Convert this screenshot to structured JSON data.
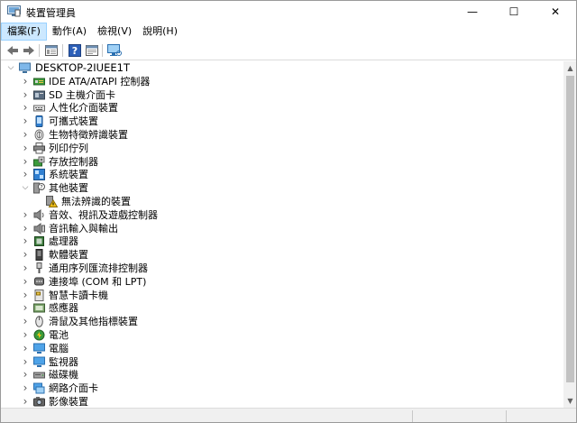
{
  "window": {
    "title": "裝置管理員",
    "minimize_glyph": "—",
    "maximize_glyph": "☐",
    "close_glyph": "✕"
  },
  "menu": [
    {
      "label": "檔案(F)",
      "active": true
    },
    {
      "label": "動作(A)",
      "active": false
    },
    {
      "label": "檢視(V)",
      "active": false
    },
    {
      "label": "說明(H)",
      "active": false
    }
  ],
  "toolbar": {
    "buttons": [
      "back-icon",
      "forward-icon",
      "properties-icon",
      "help-icon",
      "view-icon",
      "monitor-scan-icon"
    ]
  },
  "tree": {
    "root": {
      "label": "DESKTOP-2IUEE1T",
      "expanded": true
    },
    "items": [
      {
        "label": "IDE ATA/ATAPI 控制器",
        "icon": "ide-controller-icon",
        "expanded": false
      },
      {
        "label": "SD 主機介面卡",
        "icon": "sd-host-icon",
        "expanded": false
      },
      {
        "label": "人性化介面裝置",
        "icon": "hid-icon",
        "expanded": false
      },
      {
        "label": "可攜式裝置",
        "icon": "portable-device-icon",
        "expanded": false
      },
      {
        "label": "生物特徵辨識裝置",
        "icon": "biometric-icon",
        "expanded": false
      },
      {
        "label": "列印佇列",
        "icon": "printer-icon",
        "expanded": false
      },
      {
        "label": "存放控制器",
        "icon": "storage-controller-icon",
        "expanded": false
      },
      {
        "label": "系統裝置",
        "icon": "system-device-icon",
        "expanded": false
      },
      {
        "label": "其他裝置",
        "icon": "other-device-icon",
        "expanded": true,
        "children": [
          {
            "label": "無法辨識的裝置",
            "icon": "unknown-device-warning-icon"
          }
        ]
      },
      {
        "label": "音效、視訊及遊戲控制器",
        "icon": "sound-icon",
        "expanded": false
      },
      {
        "label": "音訊輸入與輸出",
        "icon": "audio-io-icon",
        "expanded": false
      },
      {
        "label": "處理器",
        "icon": "processor-icon",
        "expanded": false
      },
      {
        "label": "軟體裝置",
        "icon": "software-device-icon",
        "expanded": false
      },
      {
        "label": "通用序列匯流排控制器",
        "icon": "usb-icon",
        "expanded": false
      },
      {
        "label": "連接埠 (COM 和 LPT)",
        "icon": "port-icon",
        "expanded": false
      },
      {
        "label": "智慧卡讀卡機",
        "icon": "smartcard-icon",
        "expanded": false
      },
      {
        "label": "感應器",
        "icon": "sensor-icon",
        "expanded": false
      },
      {
        "label": "滑鼠及其他指標裝置",
        "icon": "mouse-icon",
        "expanded": false
      },
      {
        "label": "電池",
        "icon": "battery-icon",
        "expanded": false
      },
      {
        "label": "電腦",
        "icon": "computer-icon",
        "expanded": false
      },
      {
        "label": "監視器",
        "icon": "monitor-icon",
        "expanded": false
      },
      {
        "label": "磁碟機",
        "icon": "disk-drive-icon",
        "expanded": false
      },
      {
        "label": "網路介面卡",
        "icon": "network-adapter-icon",
        "expanded": false
      },
      {
        "label": "影像裝置",
        "icon": "imaging-device-icon",
        "expanded": false
      }
    ]
  },
  "colors": {
    "menu_active_bg": "#cce8ff",
    "scroll_thumb": "#c2c2c2",
    "icon_blue": "#2f7fd1",
    "icon_green": "#3a9b3a",
    "warning_yellow": "#f3c31b"
  }
}
